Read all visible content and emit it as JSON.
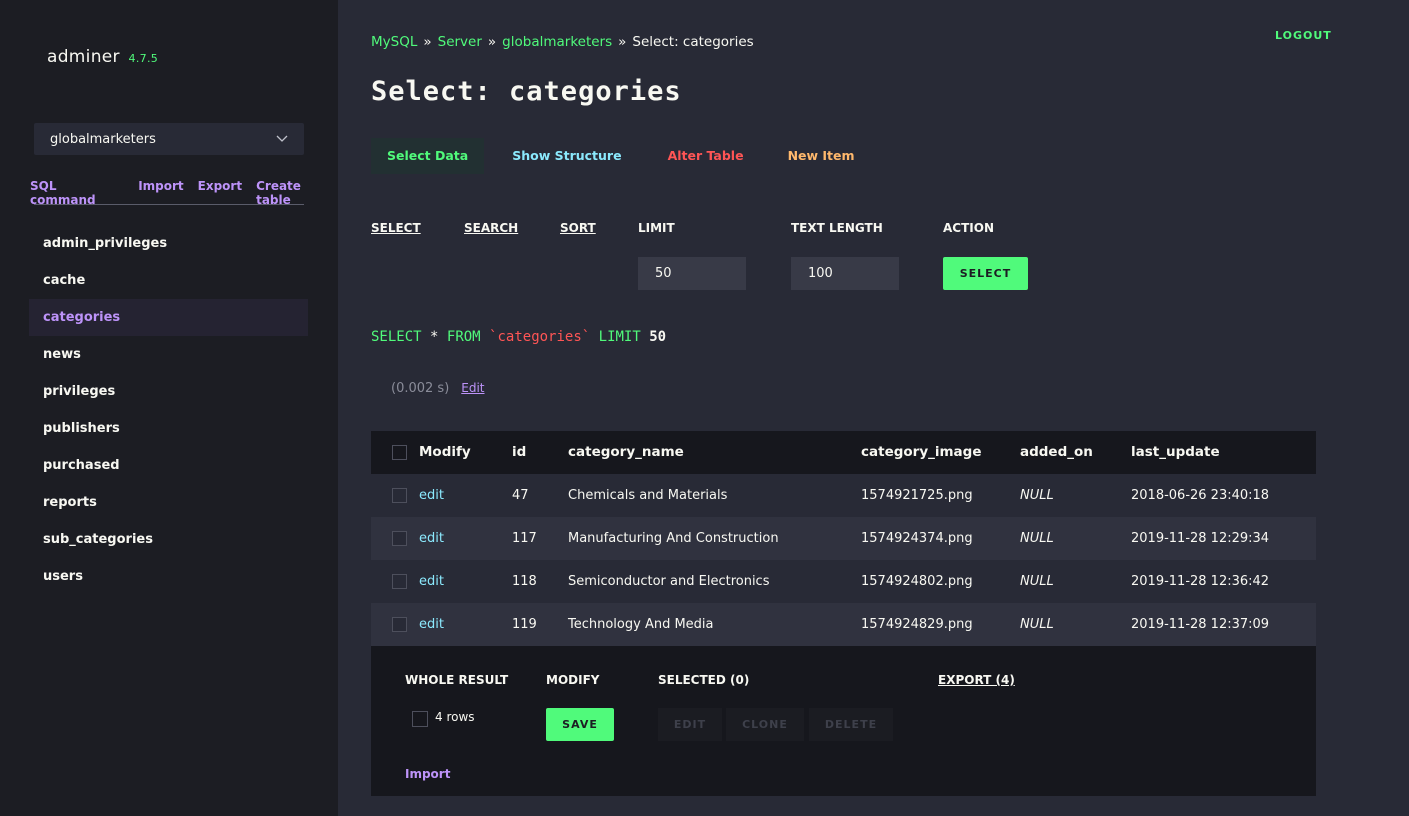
{
  "app": {
    "name": "adminer",
    "version": "4.7.5"
  },
  "sidebar": {
    "db": "globalmarketers",
    "links": [
      "SQL command",
      "Import",
      "Export",
      "Create table"
    ],
    "tables": [
      "admin_privileges",
      "cache",
      "categories",
      "news",
      "privileges",
      "publishers",
      "purchased",
      "reports",
      "sub_categories",
      "users"
    ],
    "active_table": "categories"
  },
  "breadcrumb": {
    "driver": "MySQL",
    "server": "Server",
    "db": "globalmarketers",
    "current": "Select: categories",
    "sep": "»"
  },
  "logout": "LOGOUT",
  "title": "Select: categories",
  "tabs": {
    "select_data": "Select Data",
    "show_structure": "Show Structure",
    "alter_table": "Alter Table",
    "new_item": "New Item"
  },
  "form": {
    "select": "SELECT",
    "search": "SEARCH",
    "sort": "SORT",
    "limit_label": "LIMIT",
    "limit_value": "50",
    "textlen_label": "TEXT LENGTH",
    "textlen_value": "100",
    "action_label": "ACTION",
    "action_button": "SELECT"
  },
  "query": {
    "k1": "SELECT",
    "star": "*",
    "k2": "FROM",
    "table": "`categories`",
    "k3": "LIMIT",
    "limit": "50"
  },
  "timing": {
    "time": "(0.002 s)",
    "edit": "Edit"
  },
  "grid": {
    "headers": {
      "modify": "Modify",
      "id": "id",
      "name": "category_name",
      "image": "category_image",
      "added": "added_on",
      "updated": "last_update"
    },
    "rows": [
      {
        "action": "edit",
        "id": "47",
        "name": "Chemicals and Materials",
        "image": "1574921725.png",
        "added": "NULL",
        "updated": "2018-06-26 23:40:18"
      },
      {
        "action": "edit",
        "id": "117",
        "name": "Manufacturing And Construction",
        "image": "1574924374.png",
        "added": "NULL",
        "updated": "2019-11-28 12:29:34"
      },
      {
        "action": "edit",
        "id": "118",
        "name": "Semiconductor and Electronics",
        "image": "1574924802.png",
        "added": "NULL",
        "updated": "2019-11-28 12:36:42"
      },
      {
        "action": "edit",
        "id": "119",
        "name": "Technology And Media",
        "image": "1574924829.png",
        "added": "NULL",
        "updated": "2019-11-28 12:37:09"
      }
    ]
  },
  "bottom": {
    "whole_result": "WHOLE RESULT",
    "rows_label": "4 rows",
    "modify": "MODIFY",
    "save": "SAVE",
    "selected": "SELECTED (0)",
    "edit": "EDIT",
    "clone": "CLONE",
    "delete": "DELETE",
    "export": "EXPORT (4)",
    "import": "Import"
  },
  "colors": {
    "accent_green": "#50fa7b",
    "accent_purple": "#bd93f9",
    "accent_cyan": "#8be9fd",
    "accent_red": "#ff5555",
    "accent_orange": "#ffb86c",
    "background": "#282a36",
    "sidebar": "#1c1d23"
  },
  "icons": {
    "db_dropdown": "chevron-down-icon"
  }
}
